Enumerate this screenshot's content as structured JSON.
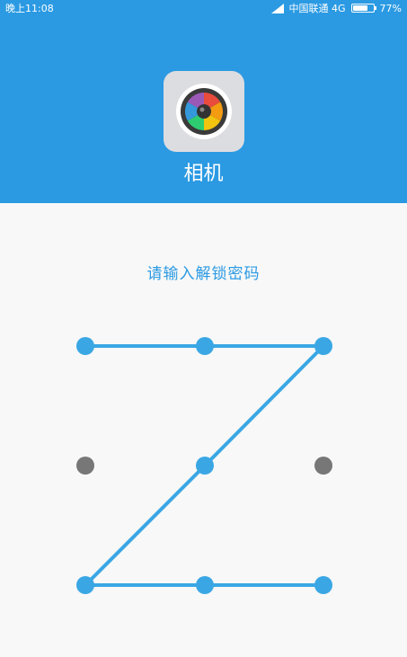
{
  "status_bar": {
    "time": "晚上11:08",
    "carrier": "中国联通 4G",
    "battery_percent": "77%",
    "battery_level": 0.77
  },
  "app": {
    "name": "相机",
    "icon": "camera-icon"
  },
  "prompt": "请输入解锁密码",
  "pattern": {
    "grid": [
      3,
      3
    ],
    "selected_sequence": [
      1,
      2,
      3,
      5,
      7,
      8,
      9
    ],
    "colors": {
      "active": "#3aa7e4",
      "inactive": "#777777",
      "header": "#2b9ae3"
    }
  }
}
